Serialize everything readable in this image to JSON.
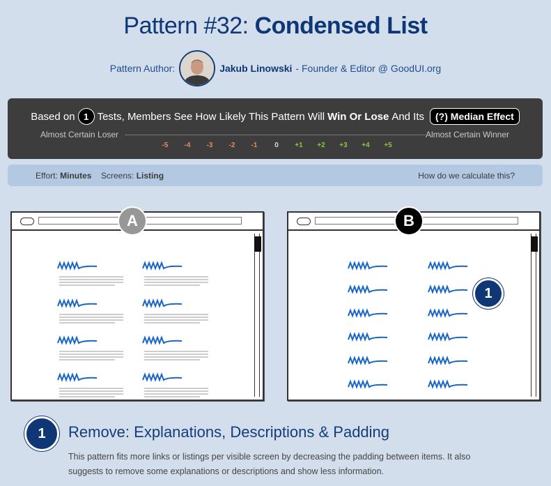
{
  "page": {
    "title_prefix": "Pattern #32: ",
    "title_name": "Condensed List"
  },
  "author": {
    "label": "Pattern Author:",
    "name": "Jakub Linowski",
    "role": "- Founder & Editor @ GoodUI.org"
  },
  "effect": {
    "based_on": "Based on",
    "tests_count": "1",
    "middle_text": "Tests, Members See How Likely This Pattern Will",
    "win_lose": "Win Or Lose",
    "and_its": "And Its",
    "median_button": "(?) Median Effect",
    "loser_label": "Almost Certain Loser",
    "winner_label": "Almost Certain Winner",
    "scale": [
      "-5",
      "-4",
      "-3",
      "-2",
      "-1",
      "0",
      "+1",
      "+2",
      "+3",
      "+4",
      "+5"
    ],
    "colors": {
      "negative": "#e8895b",
      "neutral": "#dcdcdc",
      "positive": "#8cc63f"
    }
  },
  "meta": {
    "effort_label": "Effort:",
    "effort_value": "Minutes",
    "screens_label": "Screens:",
    "screens_value": "Listing",
    "how_link": "How do we calculate this?"
  },
  "variants": {
    "a": {
      "label": "A"
    },
    "b": {
      "label": "B"
    },
    "marker": "1"
  },
  "step": {
    "number": "1",
    "title": "Remove: Explanations, Descriptions & Padding",
    "description": "This pattern fits more links or listings per visible screen by decreasing the padding between items. It also suggests to remove some explanations or descriptions and show less information."
  },
  "colors": {
    "background": "#d3deec",
    "brand_navy": "#0f3775",
    "squiggle_blue": "#1a66c4",
    "dark_panel": "#3d3d3d",
    "meta_bar": "#b3c8e1"
  }
}
